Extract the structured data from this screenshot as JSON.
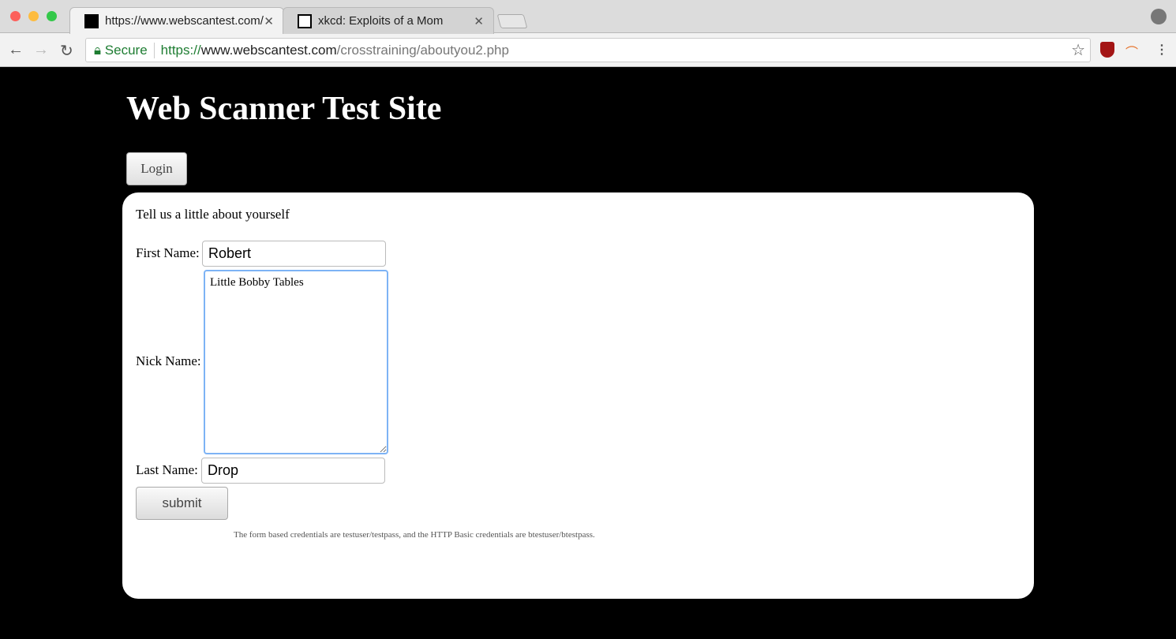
{
  "browser": {
    "tabs": [
      {
        "title": "https://www.webscantest.com/",
        "active": true
      },
      {
        "title": "xkcd: Exploits of a Mom",
        "active": false
      }
    ],
    "address": {
      "secure_label": "Secure",
      "scheme": "https://",
      "host": "www.webscantest.com",
      "path": "/crosstraining/aboutyou2.php"
    }
  },
  "page": {
    "site_title": "Web Scanner Test Site",
    "login_label": "Login",
    "form": {
      "intro": "Tell us a little about yourself",
      "first_name_label": "First Name:",
      "first_name_value": "Robert",
      "nick_name_label": "Nick Name:",
      "nick_name_value": "Little Bobby Tables",
      "last_name_label": "Last Name:",
      "last_name_value": "Drop",
      "submit_label": "submit"
    },
    "credentials_note": "The form based credentials are testuser/testpass, and the HTTP Basic credentials are btestuser/btestpass."
  }
}
